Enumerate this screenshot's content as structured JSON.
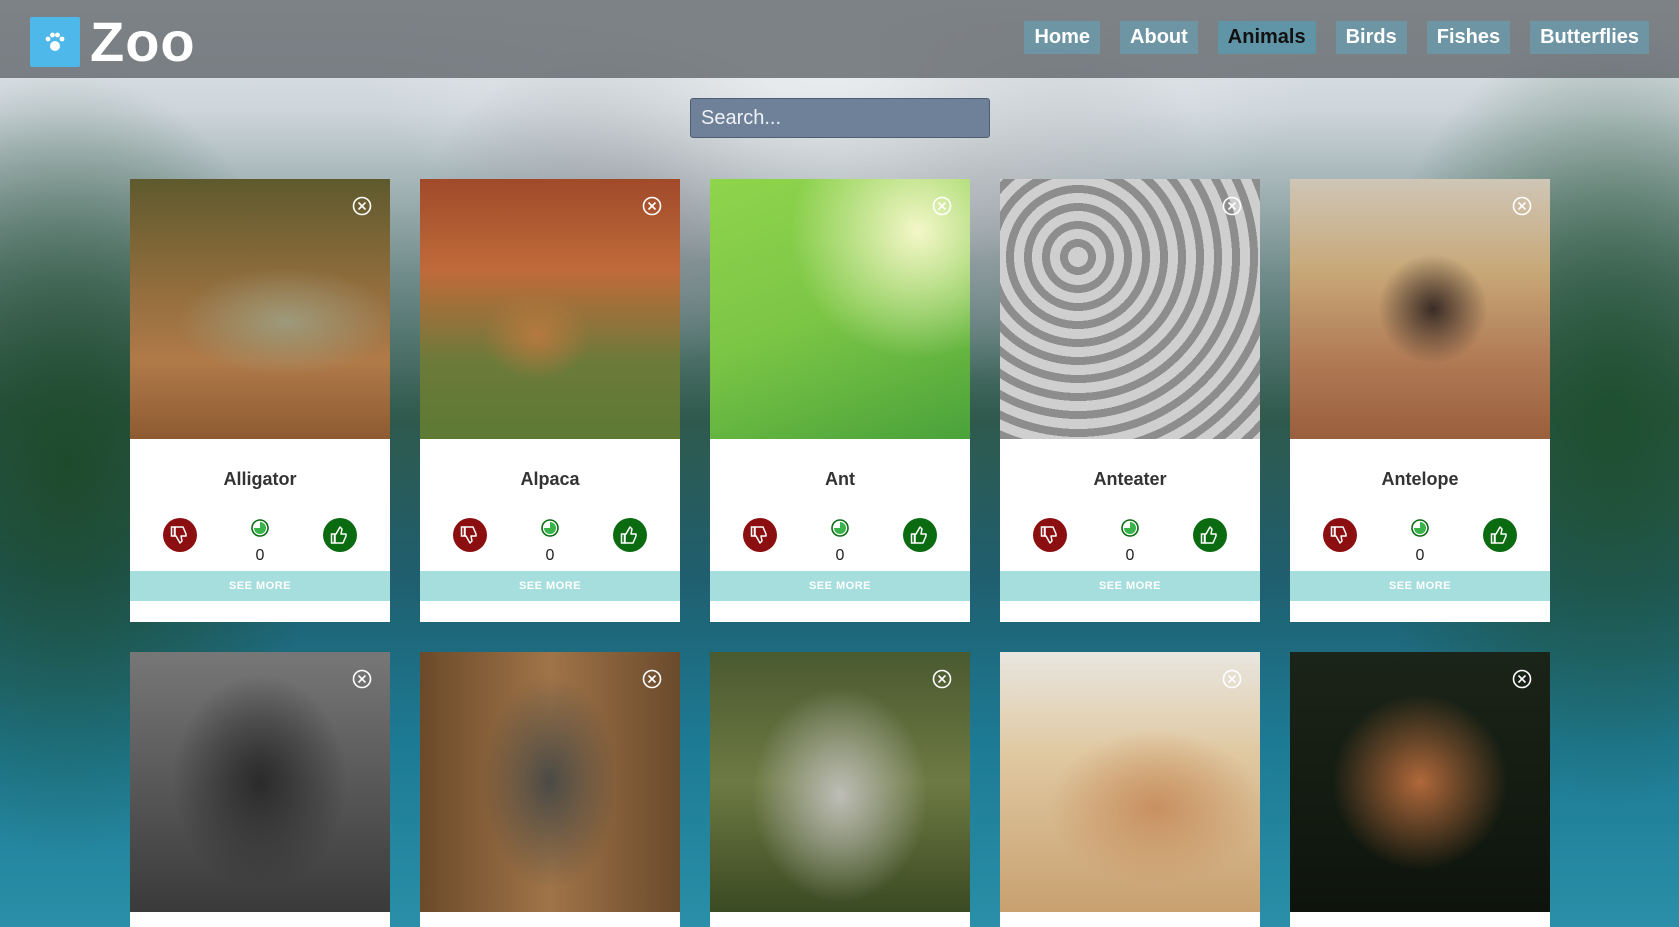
{
  "brand": {
    "name": "Zoo",
    "logo_icon": "paw-icon"
  },
  "nav": [
    {
      "label": "Home",
      "active": false
    },
    {
      "label": "About",
      "active": false
    },
    {
      "label": "Animals",
      "active": true
    },
    {
      "label": "Birds",
      "active": false
    },
    {
      "label": "Fishes",
      "active": false
    },
    {
      "label": "Butterflies",
      "active": false
    }
  ],
  "search": {
    "placeholder": "Search..."
  },
  "see_more_label": "SEE MORE",
  "colors": {
    "dislike": "#8b0f10",
    "like": "#0b6b11",
    "see_more_bg": "#a5dedd",
    "logo_bg": "#4fb8ea"
  },
  "cards": [
    {
      "name": "Alligator",
      "score": "0"
    },
    {
      "name": "Alpaca",
      "score": "0"
    },
    {
      "name": "Ant",
      "score": "0"
    },
    {
      "name": "Anteater",
      "score": "0"
    },
    {
      "name": "Antelope",
      "score": "0"
    },
    {
      "name": "",
      "score": ""
    },
    {
      "name": "",
      "score": ""
    },
    {
      "name": "",
      "score": ""
    },
    {
      "name": "",
      "score": ""
    },
    {
      "name": "",
      "score": ""
    }
  ]
}
